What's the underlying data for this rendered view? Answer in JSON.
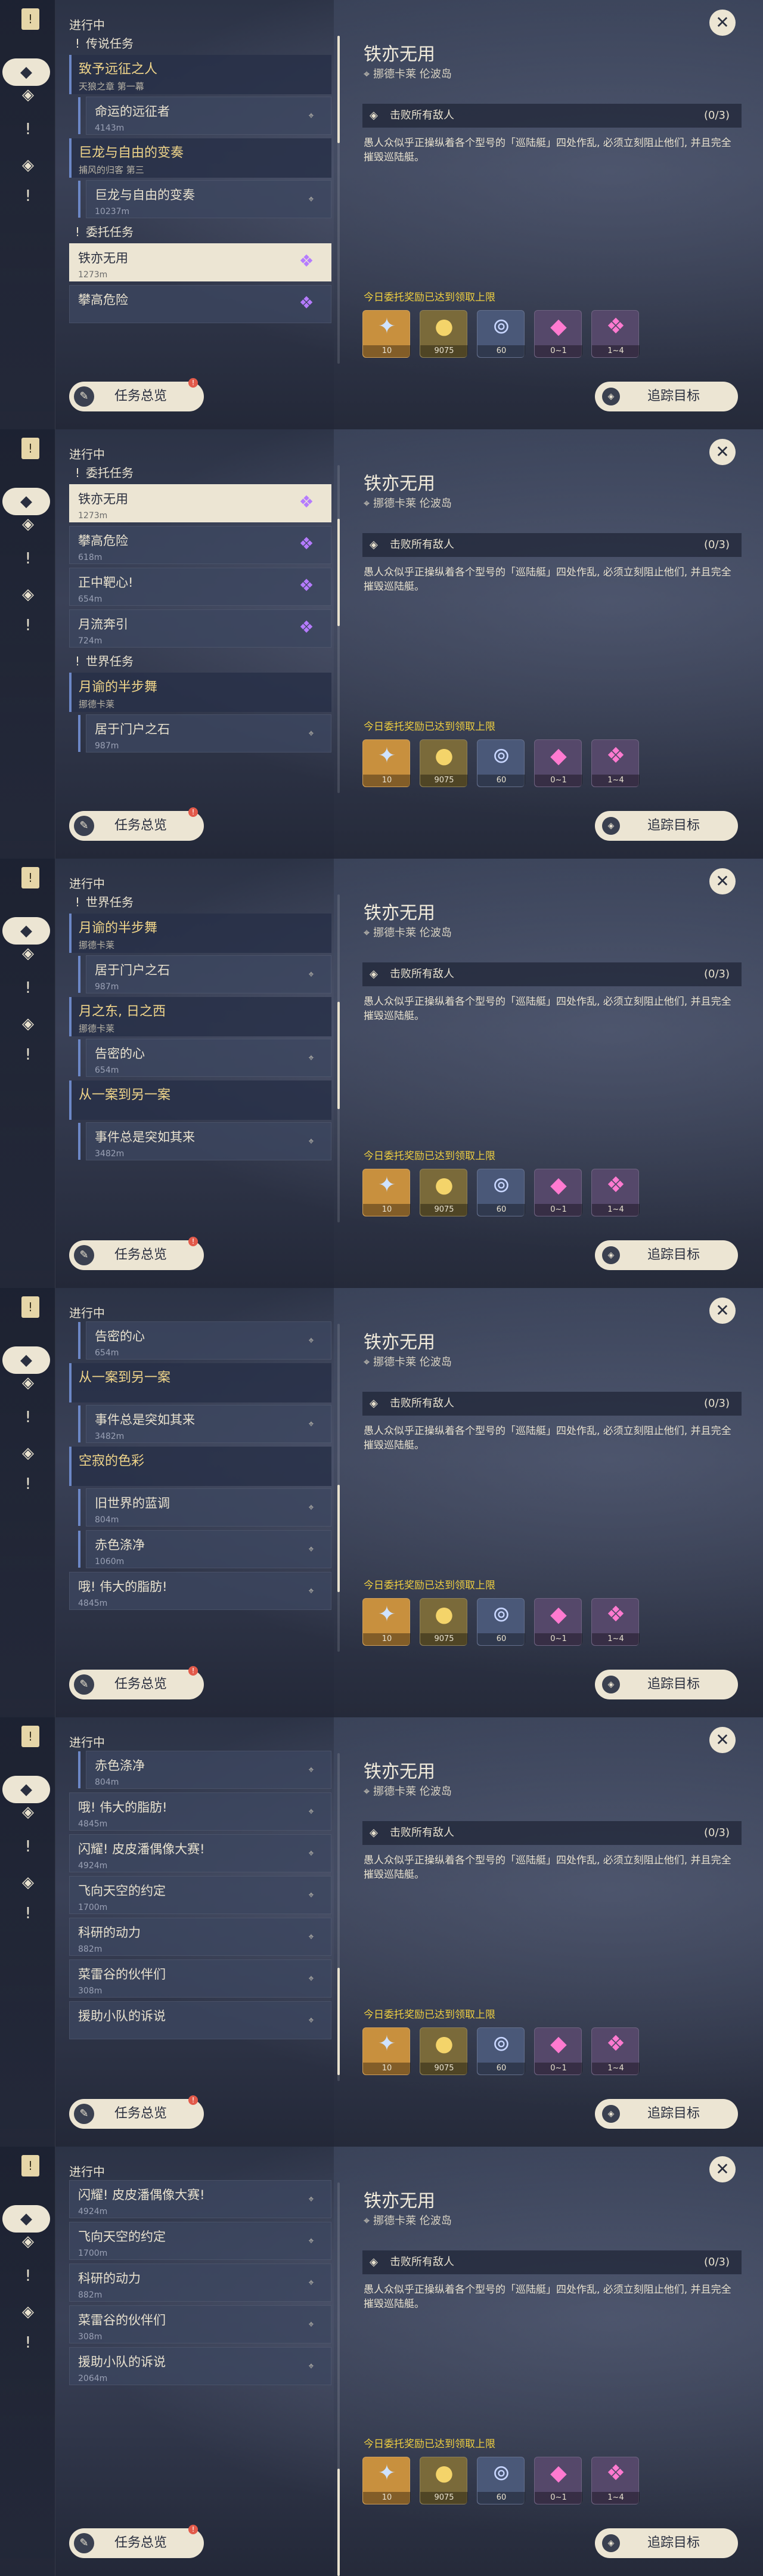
{
  "panels": [
    {
      "progress_title": "进行中",
      "sections": [
        {
          "kind": "header",
          "label": "传说任务"
        },
        {
          "kind": "group",
          "title": "致予远征之人",
          "subtitle": "天狼之章 第一幕"
        },
        {
          "kind": "item",
          "title": "命运的远征者",
          "dist": "4143m",
          "style": "sub"
        },
        {
          "kind": "group",
          "title": "巨龙与自由的变奏",
          "subtitle": "捕风的归客 第三"
        },
        {
          "kind": "item",
          "title": "巨龙与自由的变奏",
          "dist": "10237m",
          "style": "sub"
        },
        {
          "kind": "header",
          "label": "委托任务"
        },
        {
          "kind": "item",
          "title": "铁亦无用",
          "dist": "1273m",
          "style": "selected"
        },
        {
          "kind": "item",
          "title": "攀高危险",
          "dist": "",
          "style": "gem"
        }
      ]
    },
    {
      "progress_title": "进行中",
      "sections": [
        {
          "kind": "header",
          "label": "委托任务"
        },
        {
          "kind": "item",
          "title": "铁亦无用",
          "dist": "1273m",
          "style": "selected"
        },
        {
          "kind": "item",
          "title": "攀高危险",
          "dist": "618m",
          "style": "gem"
        },
        {
          "kind": "item",
          "title": "正中靶心!",
          "dist": "654m",
          "style": "gem"
        },
        {
          "kind": "item",
          "title": "月流奔引",
          "dist": "724m",
          "style": "gem"
        },
        {
          "kind": "header",
          "label": "世界任务"
        },
        {
          "kind": "group",
          "title": "月谕的半步舞",
          "subtitle": "挪德卡莱"
        },
        {
          "kind": "item",
          "title": "居于门户之石",
          "dist": "987m",
          "style": "sub"
        }
      ]
    },
    {
      "progress_title": "进行中",
      "sections": [
        {
          "kind": "header",
          "label": "世界任务"
        },
        {
          "kind": "group",
          "title": "月谕的半步舞",
          "subtitle": "挪德卡莱"
        },
        {
          "kind": "item",
          "title": "居于门户之石",
          "dist": "987m",
          "style": "sub"
        },
        {
          "kind": "group",
          "title": "月之东, 日之西",
          "subtitle": "挪德卡莱"
        },
        {
          "kind": "item",
          "title": "告密的心",
          "dist": "654m",
          "style": "sub"
        },
        {
          "kind": "group",
          "title": "从一案到另一案",
          "subtitle": ""
        },
        {
          "kind": "item",
          "title": "事件总是突如其来",
          "dist": "3482m",
          "style": "sub"
        }
      ]
    },
    {
      "progress_title": "进行中",
      "sections": [
        {
          "kind": "item",
          "title": "告密的心",
          "dist": "654m",
          "style": "sub"
        },
        {
          "kind": "group",
          "title": "从一案到另一案",
          "subtitle": ""
        },
        {
          "kind": "item",
          "title": "事件总是突如其来",
          "dist": "3482m",
          "style": "sub"
        },
        {
          "kind": "group",
          "title": "空寂的色彩",
          "subtitle": ""
        },
        {
          "kind": "item",
          "title": "旧世界的蓝调",
          "dist": "804m",
          "style": "sub"
        },
        {
          "kind": "item",
          "title": "赤色涤净",
          "dist": "1060m",
          "style": "sub"
        },
        {
          "kind": "item",
          "title": "哦! 伟大的脂肪!",
          "dist": "4845m",
          "style": "plain"
        }
      ]
    },
    {
      "progress_title": "进行中",
      "sections": [
        {
          "kind": "item",
          "title": "赤色涤净",
          "dist": "804m",
          "style": "sub"
        },
        {
          "kind": "item",
          "title": "哦! 伟大的脂肪!",
          "dist": "4845m",
          "style": "plain"
        },
        {
          "kind": "item",
          "title": "闪耀! 皮皮潘偶像大赛!",
          "dist": "4924m",
          "style": "plain"
        },
        {
          "kind": "item",
          "title": "飞向天空的约定",
          "dist": "1700m",
          "style": "plain"
        },
        {
          "kind": "item",
          "title": "科研的动力",
          "dist": "882m",
          "style": "plain"
        },
        {
          "kind": "item",
          "title": "菜雷谷的伙伴们",
          "dist": "308m",
          "style": "plain"
        },
        {
          "kind": "item",
          "title": "援助小队的诉说",
          "dist": "",
          "style": "plain"
        }
      ]
    },
    {
      "progress_title": "进行中",
      "sections": [
        {
          "kind": "item",
          "title": "闪耀! 皮皮潘偶像大赛!",
          "dist": "4924m",
          "style": "plain"
        },
        {
          "kind": "item",
          "title": "飞向天空的约定",
          "dist": "1700m",
          "style": "plain"
        },
        {
          "kind": "item",
          "title": "科研的动力",
          "dist": "882m",
          "style": "plain"
        },
        {
          "kind": "item",
          "title": "菜雷谷的伙伴们",
          "dist": "308m",
          "style": "plain"
        },
        {
          "kind": "item",
          "title": "援助小队的诉说",
          "dist": "2064m",
          "style": "plain"
        }
      ]
    }
  ],
  "detail": {
    "title": "铁亦无用",
    "location": "挪德卡莱 伦波岛",
    "objective": "击败所有敌人",
    "objective_count": "(0/3)",
    "description": "愚人众似乎正操纵着各个型号的「巡陆艇」四处作乱, 必须立刻阻止他们, 并且完全摧毁巡陆艇。",
    "reward_note": "今日委托奖励已达到领取上限",
    "rewards": [
      {
        "icon": "star-icon",
        "count": "10",
        "color": "#c8903e"
      },
      {
        "icon": "mora-icon",
        "count": "9075",
        "color": "#7a6a3a"
      },
      {
        "icon": "exp-icon",
        "count": "60",
        "color": "#4a5878"
      },
      {
        "icon": "crystal-icon",
        "count": "0~1",
        "color": "#55486a"
      },
      {
        "icon": "crystal-cluster-icon",
        "count": "1~4",
        "color": "#55486a"
      }
    ]
  },
  "buttons": {
    "overview_label": "任务总览",
    "overview_badge": "!",
    "track_label": "追踪目标",
    "close_glyph": "✕"
  },
  "rail": {
    "top_glyph": "!",
    "icons": [
      "◆",
      "◈",
      "!",
      "◈",
      "!"
    ]
  }
}
